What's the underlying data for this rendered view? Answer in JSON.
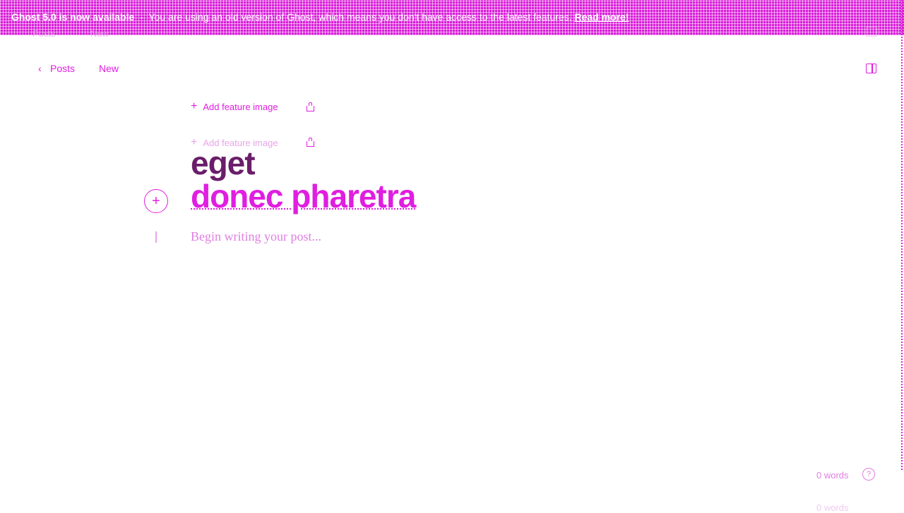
{
  "banner": {
    "bold": "Ghost 5.0 is now available",
    "separator": "-",
    "message": "You are using an old version of Ghost, which means you don't have access to the latest features.",
    "link": "Read more!"
  },
  "header": {
    "back_label": "Posts",
    "status": "New"
  },
  "editor": {
    "feature_image_label": "Add feature image",
    "title_line1": "eget",
    "title_line2": "donec pharetra",
    "body_placeholder": "Begin writing your post..."
  },
  "footer": {
    "word_count": "0 words",
    "help": "?"
  },
  "colors": {
    "accent": "#e01ee0",
    "title_dark": "#6a1e6a"
  }
}
